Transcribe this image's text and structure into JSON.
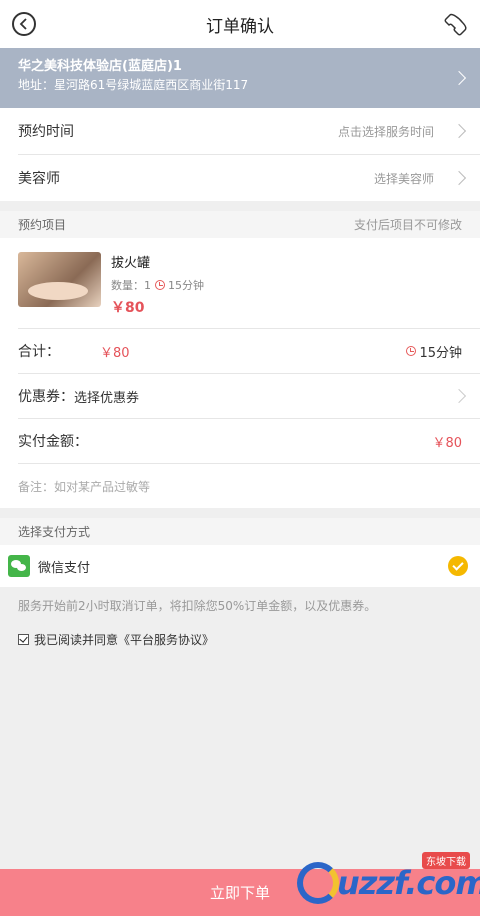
{
  "header": {
    "title": "订单确认"
  },
  "store": {
    "name": "华之美科技体验店(蓝庭店)1",
    "address": "地址：星河路61号绿城蓝庭西区商业街117"
  },
  "appointment": {
    "label": "预约时间",
    "placeholder": "点击选择服务时间"
  },
  "stylist": {
    "label": "美容师",
    "placeholder": "选择美容师"
  },
  "items_section": {
    "title": "预约项目",
    "note": "支付后项目不可修改"
  },
  "item": {
    "name": "拔火罐",
    "qty_label": "数量：1",
    "duration": "15分钟",
    "price": "￥80"
  },
  "summary": {
    "total_label": "合计：",
    "total_value": "￥80",
    "total_duration": "15分钟",
    "coupon_label": "优惠券：",
    "coupon_value": "选择优惠券",
    "pay_label": "实付金额：",
    "pay_value": "￥80",
    "remark_placeholder": "备注：如对某产品过敏等"
  },
  "payment": {
    "title": "选择支付方式",
    "method": "微信支付"
  },
  "notice": "服务开始前2小时取消订单，将扣除您50%订单金额，以及优惠券。",
  "agreement": "我已阅读并同意《平台服务协议》",
  "submit_label": "立即下单",
  "watermark": {
    "text": "uzzf.com",
    "badge": "东坡下载"
  },
  "colors": {
    "accent": "#f7818a",
    "price": "#e5535a",
    "store_bg": "#a9b4c5",
    "wechat": "#44b549",
    "check": "#f5b800"
  }
}
